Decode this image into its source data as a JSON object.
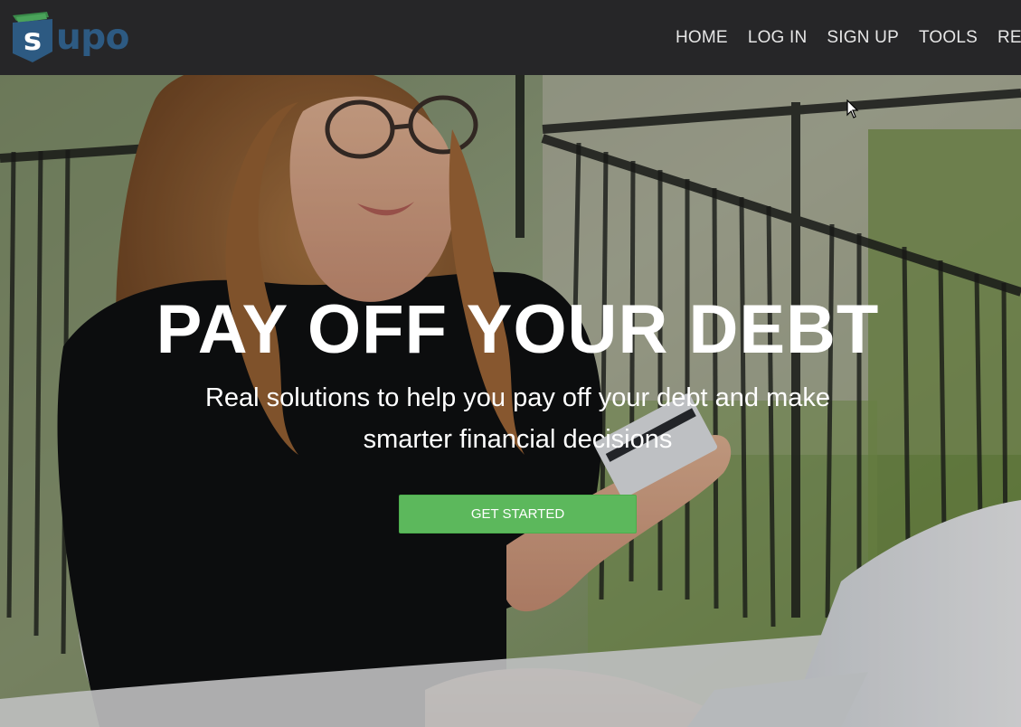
{
  "brand": {
    "logo_letter": "s",
    "logo_text": "upo",
    "colors": {
      "navbar": "#262628",
      "logo_blue": "#2d5a82",
      "logo_green": "#3a8a4a",
      "cta_green": "#5cb85c"
    }
  },
  "nav": {
    "items": [
      {
        "label": "HOME"
      },
      {
        "label": "LOG IN"
      },
      {
        "label": "SIGN UP"
      },
      {
        "label": "TOOLS"
      },
      {
        "label": "RES"
      }
    ]
  },
  "hero": {
    "title": "PAY OFF YOUR DEBT",
    "subtitle": "Real solutions to help you pay off your debt and make smarter financial decisions",
    "cta_label": "GET STARTED",
    "background": "photo-woman-with-credit-card-and-laptop"
  },
  "icons": {
    "cursor": "mouse-pointer-icon"
  }
}
